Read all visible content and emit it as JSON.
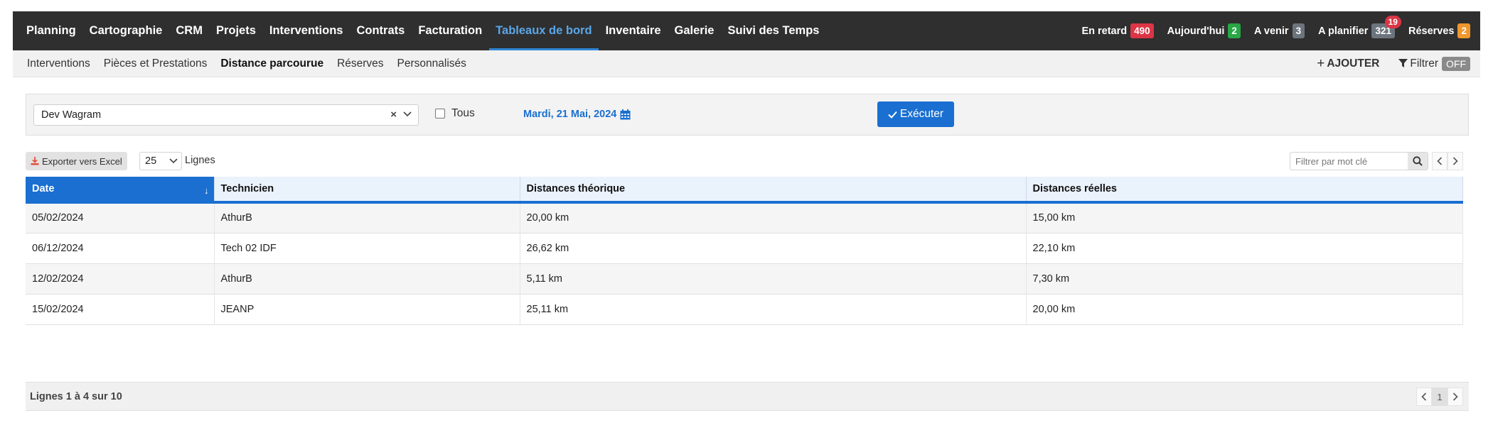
{
  "nav": {
    "items": [
      {
        "label": "Planning"
      },
      {
        "label": "Cartographie"
      },
      {
        "label": "CRM"
      },
      {
        "label": "Projets"
      },
      {
        "label": "Interventions"
      },
      {
        "label": "Contrats"
      },
      {
        "label": "Facturation"
      },
      {
        "label": "Tableaux de bord"
      },
      {
        "label": "Inventaire"
      },
      {
        "label": "Galerie"
      },
      {
        "label": "Suivi des Temps"
      }
    ],
    "active": "Tableaux de bord",
    "stats": [
      {
        "label": "En retard",
        "count": "490",
        "color": "#dc3545"
      },
      {
        "label": "Aujourd'hui",
        "count": "2",
        "color": "#28a745"
      },
      {
        "label": "A venir",
        "count": "3",
        "color": "#6c757d"
      },
      {
        "label": "A planifier",
        "count": "321",
        "color": "#6c757d",
        "notification": "19"
      },
      {
        "label": "Réserves",
        "count": "2",
        "color": "#f0962d"
      }
    ]
  },
  "subnav": {
    "items": [
      {
        "label": "Interventions"
      },
      {
        "label": "Pièces et Prestations"
      },
      {
        "label": "Distance parcourue"
      },
      {
        "label": "Réserves"
      },
      {
        "label": "Personnalisés"
      }
    ],
    "active": "Distance parcourue",
    "add_label": "AJOUTER",
    "filter_label": "Filtrer",
    "filter_state": "OFF"
  },
  "filters": {
    "agency_value": "Dev Wagram",
    "all_label": "Tous",
    "date_label": "Mardi, 21 Mai, 2024",
    "execute_label": "Exécuter"
  },
  "toolbar": {
    "export_label": "Exporter vers Excel",
    "rows_value": "25",
    "rows_label": "Lignes",
    "search_placeholder": "Filtrer par mot clé"
  },
  "table": {
    "columns": [
      "Date",
      "Technicien",
      "Distances théorique",
      "Distances réelles"
    ],
    "sorted_column": "Date",
    "rows": [
      [
        "05/02/2024",
        "AthurB",
        "20,00 km",
        "15,00 km"
      ],
      [
        "06/12/2024",
        "Tech 02 IDF",
        "26,62 km",
        "22,10 km"
      ],
      [
        "12/02/2024",
        "AthurB",
        "5,11 km",
        "7,30 km"
      ],
      [
        "15/02/2024",
        "JEANP",
        "25,11 km",
        "20,00 km"
      ]
    ]
  },
  "footer": {
    "summary": "Lignes 1 à 4 sur 10",
    "current_page": "1"
  },
  "colors": {
    "topbar": "#2f2f2f",
    "accent": "#1a6fd1",
    "active_nav": "#5aa6e8"
  }
}
